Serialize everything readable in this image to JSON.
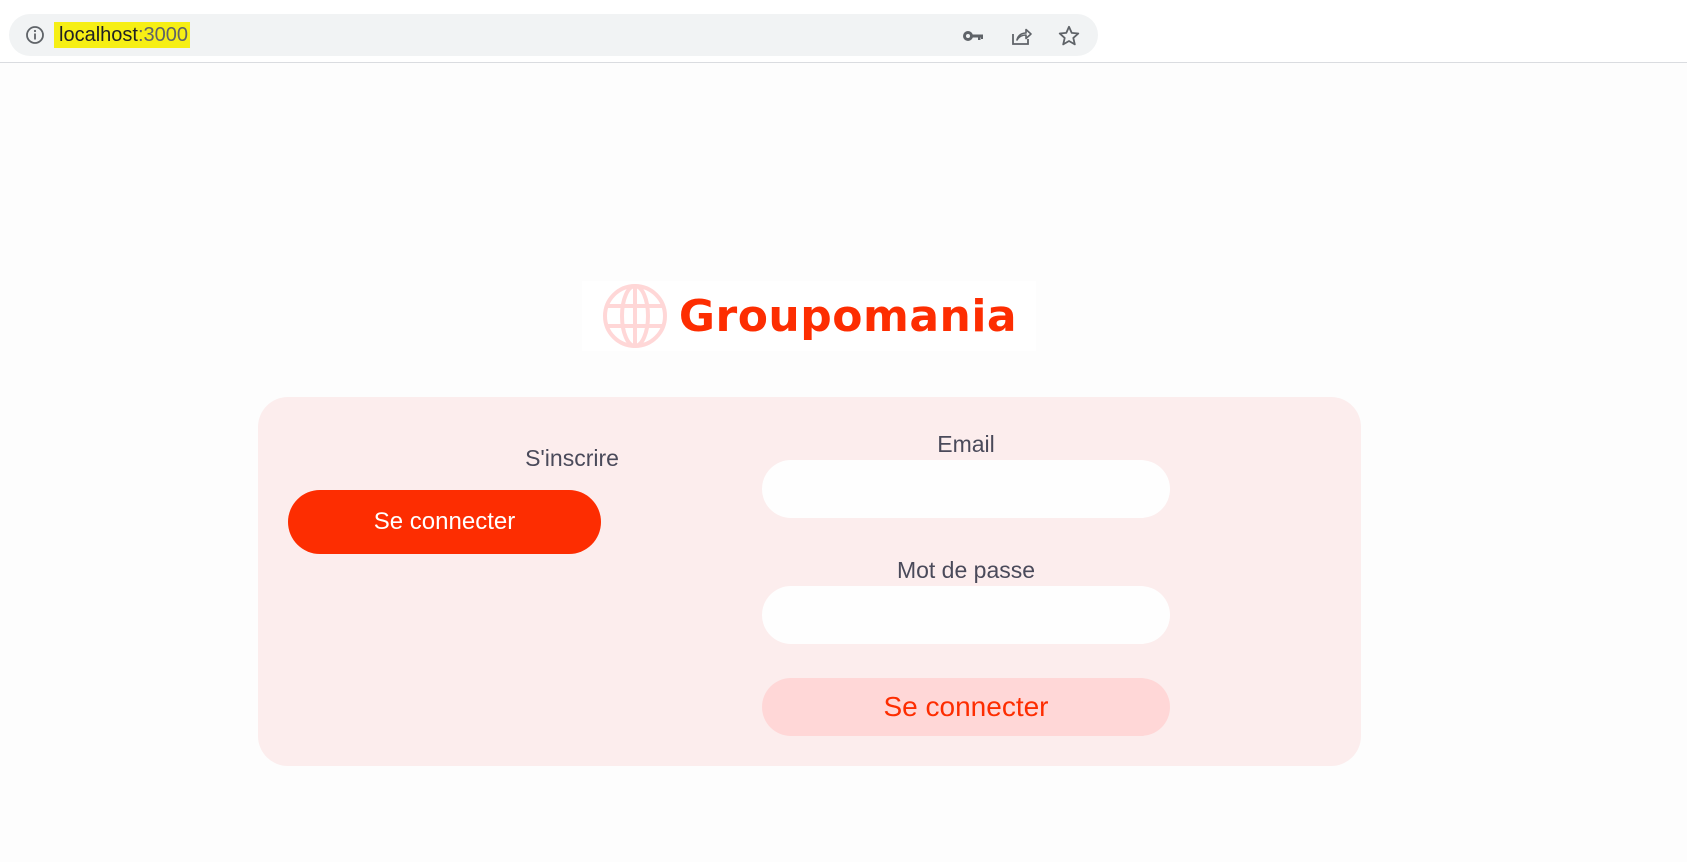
{
  "browser": {
    "url_host": "localhost",
    "url_port": ":3000",
    "icons": [
      "info-icon",
      "key-icon",
      "share-icon",
      "star-icon"
    ]
  },
  "logo": {
    "brand_name": "Groupomania",
    "icon": "globe-icon"
  },
  "card": {
    "signup_label": "S'inscrire",
    "toggle_button_label": "Se connecter",
    "email_label": "Email",
    "email_value": "",
    "password_label": "Mot de passe",
    "password_value": "",
    "submit_button_label": "Se connecter"
  },
  "colors": {
    "primary": "#fd2d01",
    "secondary": "#ffd7d7",
    "card_background": "#fceded",
    "text": "#4a4a5a",
    "url_highlight": "#f6ef15"
  }
}
